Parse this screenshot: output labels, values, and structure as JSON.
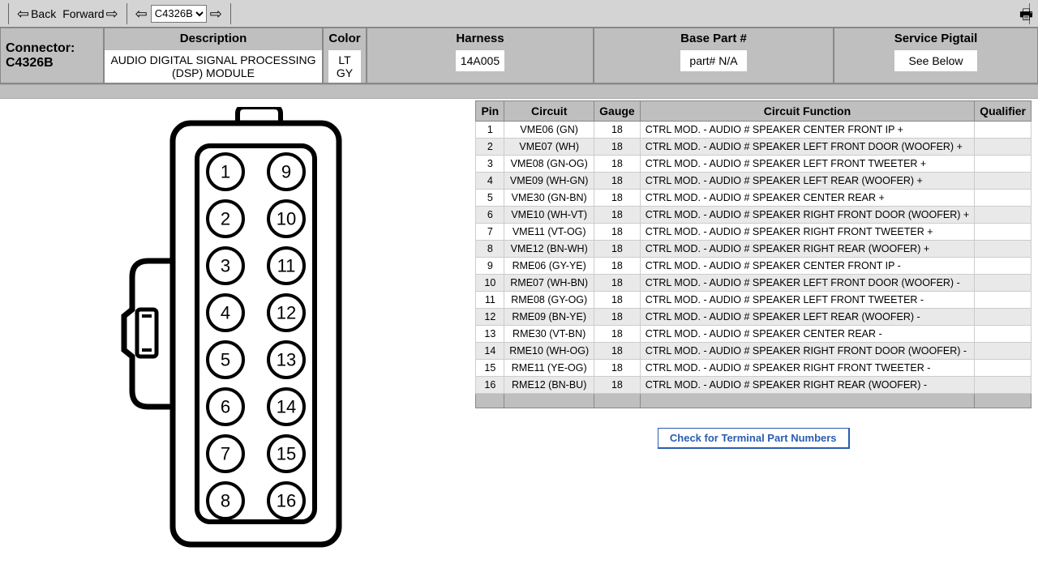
{
  "toolbar": {
    "back_label": "Back",
    "forward_label": "Forward",
    "select_value": "C4326B"
  },
  "header": {
    "connector_heading": "Connector:",
    "connector_id": "C4326B",
    "description_label": "Description",
    "description_value": "AUDIO DIGITAL SIGNAL PROCESSING (DSP) MODULE",
    "color_label": "Color",
    "color_value1": "LT",
    "color_value2": "GY",
    "harness_label": "Harness",
    "harness_value": "14A005",
    "base_label": "Base Part #",
    "base_value": "part# N/A",
    "pigtail_label": "Service Pigtail",
    "pigtail_value": "See Below"
  },
  "table": {
    "cols": {
      "pin": "Pin",
      "circuit": "Circuit",
      "gauge": "Gauge",
      "func": "Circuit Function",
      "qual": "Qualifier"
    },
    "rows": [
      {
        "pin": "1",
        "circuit": "VME06 (GN)",
        "gauge": "18",
        "func": "CTRL MOD. - AUDIO # SPEAKER CENTER FRONT IP +",
        "qual": ""
      },
      {
        "pin": "2",
        "circuit": "VME07 (WH)",
        "gauge": "18",
        "func": "CTRL MOD. - AUDIO # SPEAKER LEFT FRONT DOOR (WOOFER) +",
        "qual": ""
      },
      {
        "pin": "3",
        "circuit": "VME08 (GN-OG)",
        "gauge": "18",
        "func": "CTRL MOD. - AUDIO # SPEAKER LEFT FRONT TWEETER +",
        "qual": ""
      },
      {
        "pin": "4",
        "circuit": "VME09 (WH-GN)",
        "gauge": "18",
        "func": "CTRL MOD. - AUDIO # SPEAKER LEFT REAR (WOOFER) +",
        "qual": ""
      },
      {
        "pin": "5",
        "circuit": "VME30 (GN-BN)",
        "gauge": "18",
        "func": "CTRL MOD. - AUDIO # SPEAKER CENTER REAR +",
        "qual": ""
      },
      {
        "pin": "6",
        "circuit": "VME10 (WH-VT)",
        "gauge": "18",
        "func": "CTRL MOD. - AUDIO # SPEAKER RIGHT FRONT DOOR (WOOFER) +",
        "qual": ""
      },
      {
        "pin": "7",
        "circuit": "VME11 (VT-OG)",
        "gauge": "18",
        "func": "CTRL MOD. - AUDIO # SPEAKER RIGHT FRONT TWEETER +",
        "qual": ""
      },
      {
        "pin": "8",
        "circuit": "VME12 (BN-WH)",
        "gauge": "18",
        "func": "CTRL MOD. - AUDIO # SPEAKER RIGHT REAR (WOOFER) +",
        "qual": ""
      },
      {
        "pin": "9",
        "circuit": "RME06 (GY-YE)",
        "gauge": "18",
        "func": "CTRL MOD. - AUDIO # SPEAKER CENTER FRONT IP -",
        "qual": ""
      },
      {
        "pin": "10",
        "circuit": "RME07 (WH-BN)",
        "gauge": "18",
        "func": "CTRL MOD. - AUDIO # SPEAKER LEFT FRONT DOOR (WOOFER) -",
        "qual": ""
      },
      {
        "pin": "11",
        "circuit": "RME08 (GY-OG)",
        "gauge": "18",
        "func": "CTRL MOD. - AUDIO # SPEAKER LEFT FRONT TWEETER -",
        "qual": ""
      },
      {
        "pin": "12",
        "circuit": "RME09 (BN-YE)",
        "gauge": "18",
        "func": "CTRL MOD. - AUDIO # SPEAKER LEFT REAR (WOOFER) -",
        "qual": ""
      },
      {
        "pin": "13",
        "circuit": "RME30 (VT-BN)",
        "gauge": "18",
        "func": "CTRL MOD. - AUDIO # SPEAKER CENTER REAR -",
        "qual": ""
      },
      {
        "pin": "14",
        "circuit": "RME10 (WH-OG)",
        "gauge": "18",
        "func": "CTRL MOD. - AUDIO # SPEAKER RIGHT FRONT DOOR (WOOFER) -",
        "qual": ""
      },
      {
        "pin": "15",
        "circuit": "RME11 (YE-OG)",
        "gauge": "18",
        "func": "CTRL MOD. - AUDIO # SPEAKER RIGHT FRONT TWEETER -",
        "qual": ""
      },
      {
        "pin": "16",
        "circuit": "RME12 (BN-BU)",
        "gauge": "18",
        "func": "CTRL MOD. - AUDIO # SPEAKER RIGHT REAR (WOOFER) -",
        "qual": ""
      }
    ]
  },
  "check_button": "Check for Terminal Part Numbers",
  "connector_pins": {
    "left": [
      "1",
      "2",
      "3",
      "4",
      "5",
      "6",
      "7",
      "8"
    ],
    "right": [
      "9",
      "10",
      "11",
      "12",
      "13",
      "14",
      "15",
      "16"
    ]
  }
}
